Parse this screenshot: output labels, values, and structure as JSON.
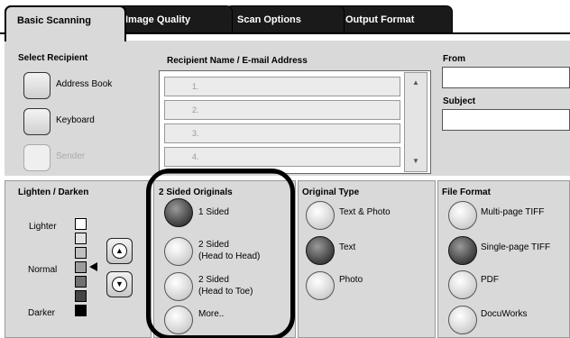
{
  "tabs": [
    {
      "label": "Basic Scanning"
    },
    {
      "label": "Image Quality"
    },
    {
      "label": "Scan Options"
    },
    {
      "label": "Output Format"
    }
  ],
  "select_recipient": {
    "heading": "Select Recipient",
    "address_book": "Address Book",
    "keyboard": "Keyboard",
    "sender": "Sender"
  },
  "recipient_list": {
    "heading": "Recipient Name / E-mail Address",
    "rows": [
      "1.",
      "2.",
      "3.",
      "4."
    ]
  },
  "from": {
    "heading": "From"
  },
  "subject": {
    "heading": "Subject"
  },
  "lighten_darken": {
    "heading": "Lighten / Darken",
    "lighter": "Lighter",
    "normal": "Normal",
    "darker": "Darker"
  },
  "two_sided": {
    "heading": "2 Sided Originals",
    "options": [
      "1 Sided",
      "2 Sided\n(Head to Head)",
      "2 Sided\n(Head to Toe)",
      "More.."
    ],
    "selected": 0
  },
  "original_type": {
    "heading": "Original Type",
    "options": [
      "Text & Photo",
      "Text",
      "Photo"
    ],
    "selected": 1
  },
  "file_format": {
    "heading": "File Format",
    "options": [
      "Multi-page TIFF",
      "Single-page TIFF",
      "PDF",
      "DocuWorks"
    ],
    "selected": 1
  }
}
